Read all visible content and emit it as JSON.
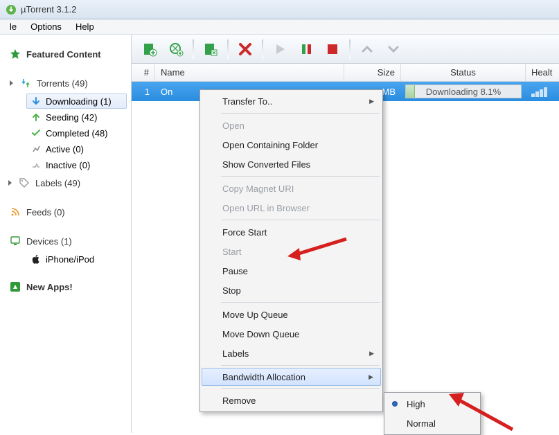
{
  "title": "µTorrent 3.1.2",
  "menubar": {
    "file": "le",
    "options": "Options",
    "help": "Help"
  },
  "sidebar": {
    "featured": "Featured Content",
    "torrents": {
      "label": "Torrents (49)",
      "downloading": "Downloading (1)",
      "seeding": "Seeding (42)",
      "completed": "Completed (48)",
      "active": "Active (0)",
      "inactive": "Inactive (0)",
      "labels": "Labels (49)"
    },
    "feeds": "Feeds (0)",
    "devices": {
      "label": "Devices (1)",
      "iphone": "iPhone/iPod"
    },
    "newapps": "New Apps!"
  },
  "columns": {
    "num": "#",
    "name": "Name",
    "size": "Size",
    "status": "Status",
    "health": "Healt"
  },
  "row": {
    "num": "1",
    "name": "On",
    "size": "MB",
    "status": "Downloading 8.1%",
    "pct": 8.1
  },
  "contextmenu": {
    "transfer": "Transfer To..",
    "open": "Open",
    "openfolder": "Open Containing Folder",
    "showconv": "Show Converted Files",
    "copymagnet": "Copy Magnet URI",
    "openurl": "Open URL in Browser",
    "forcestart": "Force Start",
    "start": "Start",
    "pause": "Pause",
    "stop": "Stop",
    "moveup": "Move Up Queue",
    "movedown": "Move Down Queue",
    "labels": "Labels",
    "bandwidth": "Bandwidth Allocation",
    "remove": "Remove"
  },
  "submenu": {
    "high": "High",
    "normal": "Normal"
  }
}
